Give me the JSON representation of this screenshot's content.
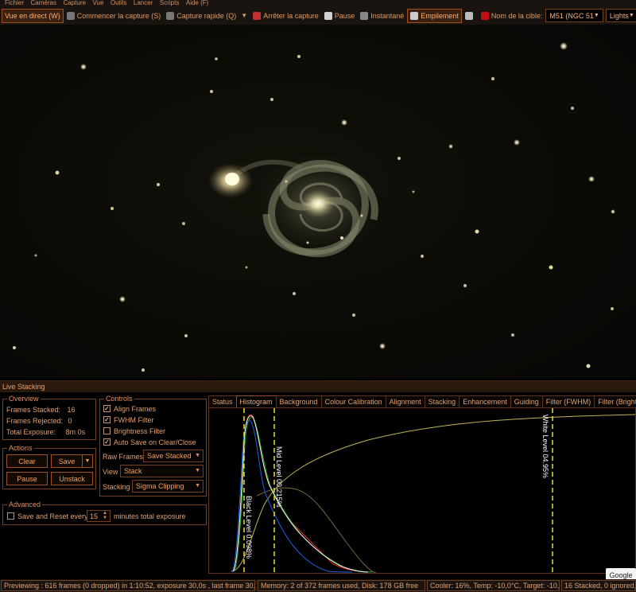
{
  "menu": [
    "Fichier",
    "Caméras",
    "Capture",
    "Vue",
    "Outils",
    "Lancer",
    "Scripts",
    "Aide (F)"
  ],
  "toolbar": {
    "live_view": "Vue en direct (W)",
    "start_capture": "Commencer la capture (S)",
    "quick_capture": "Capture rapide (Q)",
    "stop_capture": "Arrêter la capture",
    "pause": "Pause",
    "snapshot": "Instantané",
    "stacking": "Empilement",
    "target_label": "Nom de la cible:",
    "target_value": "M51 (NGC 51",
    "frame_type": "Lights"
  },
  "panel": {
    "title": "Live Stacking",
    "overview": {
      "title": "Overview",
      "frames_stacked_label": "Frames Stacked:",
      "frames_stacked": "16",
      "frames_rejected_label": "Frames Rejected:",
      "frames_rejected": "0",
      "total_exposure_label": "Total Exposure:",
      "total_exposure": "8m 0s"
    },
    "actions": {
      "title": "Actions",
      "clear": "Clear",
      "save": "Save",
      "pause": "Pause",
      "unstack": "Unstack"
    },
    "advanced": {
      "title": "Advanced",
      "save_reset_label": "Save and Reset every",
      "minutes_value": "15",
      "minutes_suffix": "minutes total exposure"
    },
    "controls": {
      "title": "Controls",
      "align_frames": "Align Frames",
      "fwhm_filter": "FWHM Filter",
      "brightness_filter": "Brightness Filter",
      "auto_save": "Auto Save on Clear/Close",
      "raw_frames_label": "Raw Frames",
      "raw_frames_value": "Save Stacked",
      "view_label": "View",
      "view_value": "Stack",
      "stacking_label": "Stacking",
      "stacking_value": "Sigma Clipping"
    },
    "tabs": [
      "Status",
      "Histogram",
      "Background",
      "Colour Calibration",
      "Alignment",
      "Stacking",
      "Enhancement",
      "Guiding",
      "Filter (FWHM)",
      "Filter (Brightne"
    ],
    "active_tab": 1,
    "histogram": {
      "black_level": "Black Level 0.098%",
      "mid_level": "Mid Level 00.215%",
      "white_level": "White Level 04.95%"
    }
  },
  "statusbar": {
    "preview": "Previewing : 616 frames (0 dropped) in 1:10:52, exposure 30,0s , last frame 30,0s",
    "memory": "Memory: 2 of 372 frames used, Disk: 178 GB free",
    "cooler": "Cooler: 16%, Temp: -10,0°C, Target: -10,0°",
    "stacked": "16 Stacked, 0 ignored,"
  },
  "google_badge": "Google",
  "colors": {
    "accent": "#e09a60",
    "border": "#a05020",
    "background": "#000000"
  }
}
